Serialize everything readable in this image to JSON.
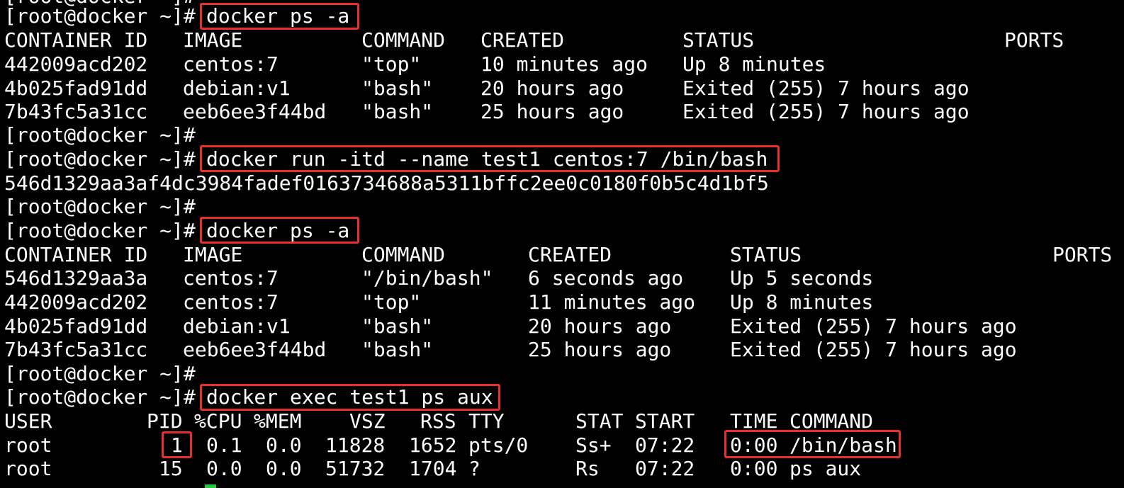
{
  "terminal": {
    "prompt": "[root@docker ~]#",
    "highlight_color": "#e8302a",
    "cursor_color": "#27c93f"
  },
  "cmd1": {
    "command": "docker ps -a"
  },
  "ps1": {
    "headers": [
      "CONTAINER ID",
      "IMAGE",
      "COMMAND",
      "CREATED",
      "STATUS",
      "PORTS"
    ],
    "rows": [
      [
        "442009acd202",
        "centos:7",
        "\"top\"",
        "10 minutes ago",
        "Up 8 minutes"
      ],
      [
        "4b025fad91dd",
        "debian:v1",
        "\"bash\"",
        "20 hours ago",
        "Exited (255) 7 hours ago"
      ],
      [
        "7b43fc5a31cc",
        "eeb6ee3f44bd",
        "\"bash\"",
        "25 hours ago",
        "Exited (255) 7 hours ago"
      ]
    ]
  },
  "cmd2": {
    "command": "docker run -itd --name test1 centos:7 /bin/bash",
    "output": "546d1329aa3af4dc3984fadef0163734688a5311bffc2ee0c0180f0b5c4d1bf5"
  },
  "cmd3": {
    "command": "docker ps -a"
  },
  "ps2": {
    "headers": [
      "CONTAINER ID",
      "IMAGE",
      "COMMAND",
      "CREATED",
      "STATUS",
      "PORTS"
    ],
    "rows": [
      [
        "546d1329aa3a",
        "centos:7",
        "\"/bin/bash\"",
        "6 seconds ago",
        "Up 5 seconds"
      ],
      [
        "442009acd202",
        "centos:7",
        "\"top\"",
        "11 minutes ago",
        "Up 8 minutes"
      ],
      [
        "4b025fad91dd",
        "debian:v1",
        "\"bash\"",
        "20 hours ago",
        "Exited (255) 7 hours ago"
      ],
      [
        "7b43fc5a31cc",
        "eeb6ee3f44bd",
        "\"bash\"",
        "25 hours ago",
        "Exited (255) 7 hours ago"
      ]
    ]
  },
  "cmd4": {
    "command": "docker exec test1 ps aux"
  },
  "psaux": {
    "headers": [
      "USER",
      "PID",
      "%CPU",
      "%MEM",
      "VSZ",
      "RSS",
      "TTY",
      "STAT",
      "START",
      "TIME",
      "COMMAND"
    ],
    "rows": [
      [
        "root",
        "1",
        "0.1",
        "0.0",
        "11828",
        "1652",
        "pts/0",
        "Ss+",
        "07:22",
        "0:00",
        "/bin/bash"
      ],
      [
        "root",
        "15",
        "0.0",
        "0.0",
        "51732",
        "1704",
        "?",
        "Rs",
        "07:22",
        "0:00",
        "ps aux"
      ]
    ]
  }
}
